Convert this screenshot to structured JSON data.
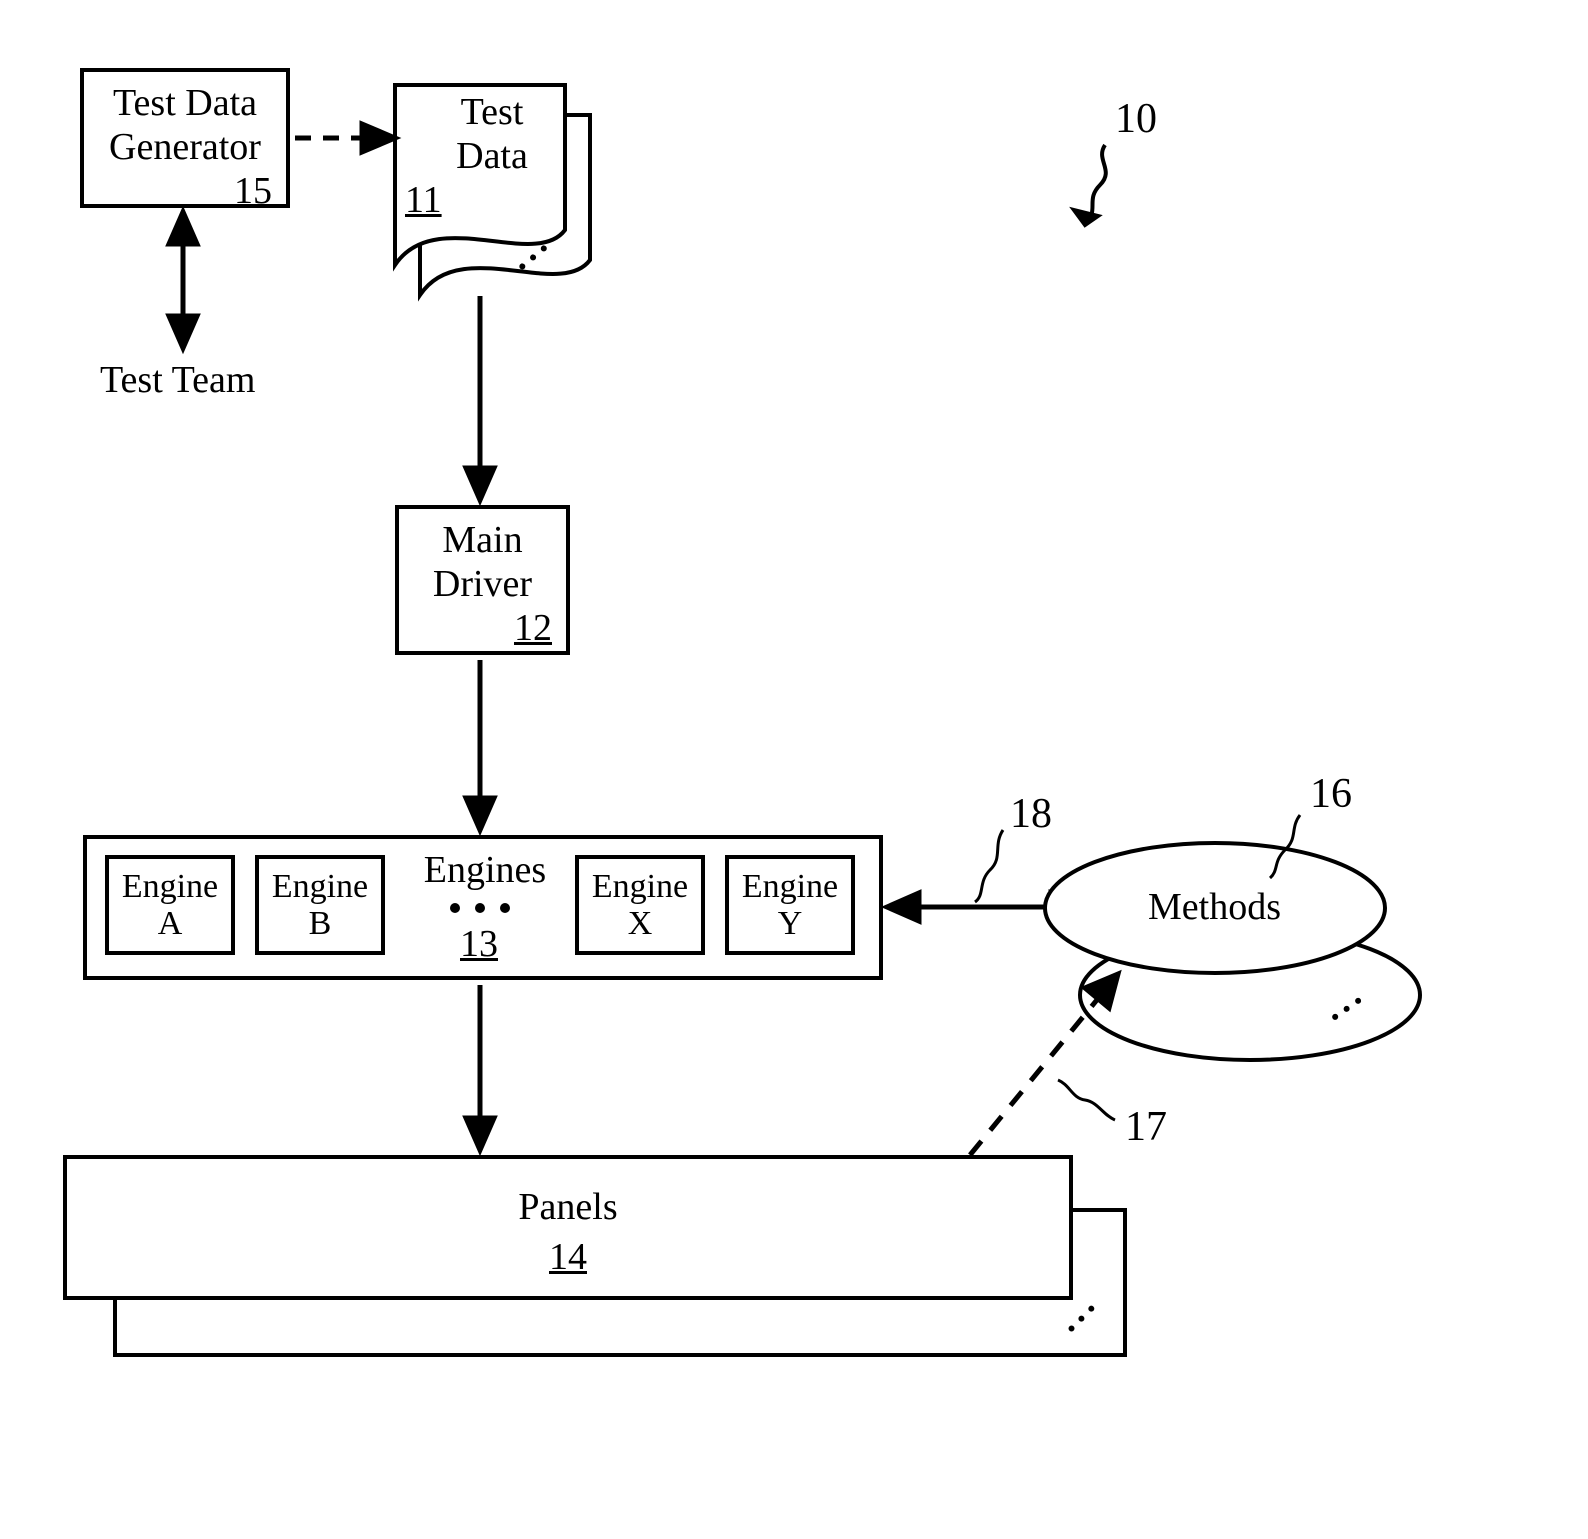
{
  "diagram": {
    "ref": "10",
    "testTeam": "Test Team",
    "testDataGenerator": {
      "label": "Test Data\nGenerator",
      "num": "15"
    },
    "testData": {
      "label": "Test\nData",
      "num": "11"
    },
    "mainDriver": {
      "label": "Main\nDriver",
      "num": "12"
    },
    "engines": {
      "label": "Engines",
      "num": "13",
      "items": [
        {
          "label": "Engine\nA"
        },
        {
          "label": "Engine\nB"
        },
        {
          "label": "Engine\nX"
        },
        {
          "label": "Engine\nY"
        }
      ]
    },
    "methods": {
      "label": "Methods",
      "num": "16"
    },
    "panels": {
      "label": "Panels",
      "num": "14"
    },
    "refs": {
      "r17": "17",
      "r18": "18"
    }
  }
}
